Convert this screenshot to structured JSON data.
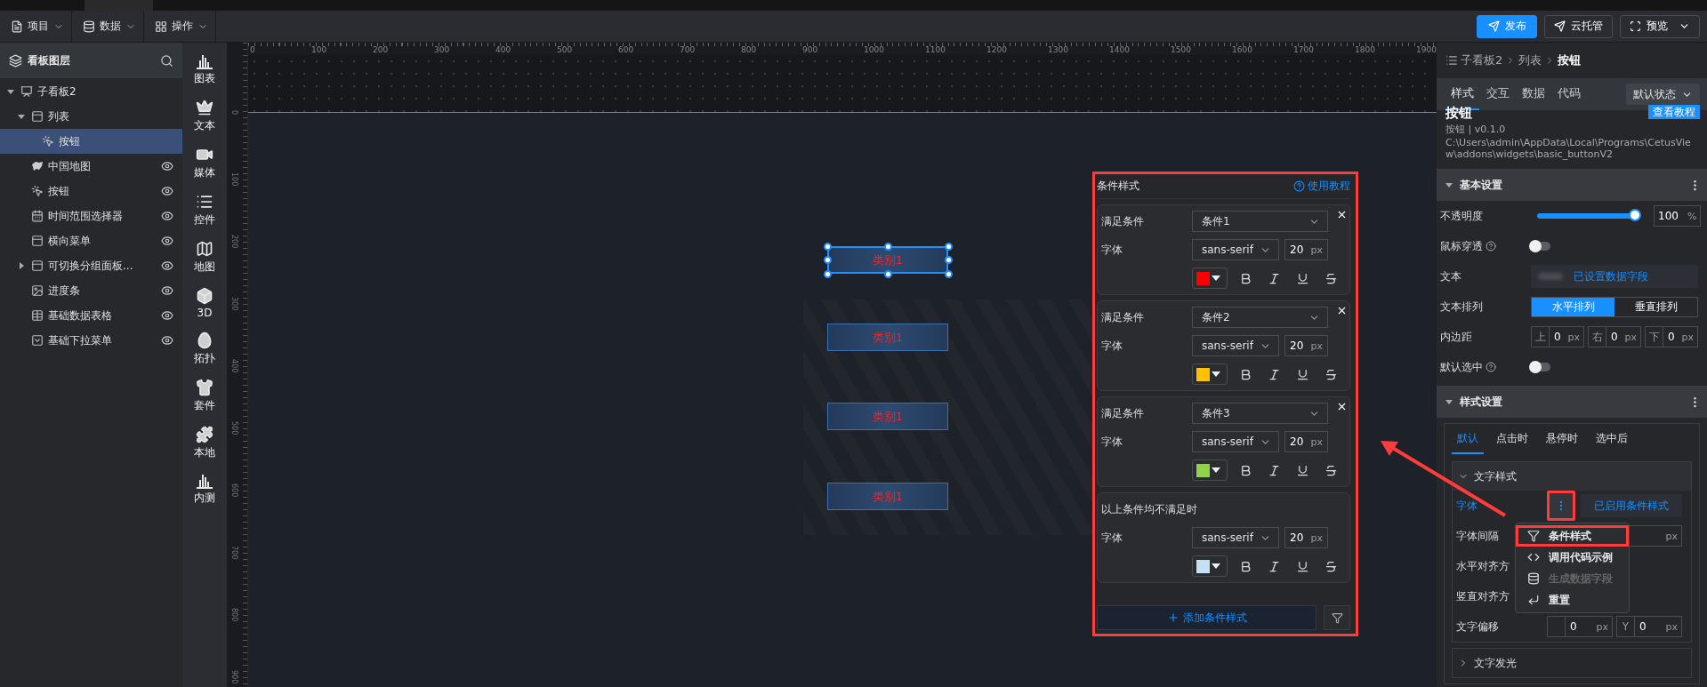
{
  "menubar": [
    {
      "label": "项目",
      "kind": "file"
    },
    {
      "label": "数据",
      "kind": "database"
    },
    {
      "label": "操作",
      "kind": "grid"
    }
  ],
  "actions": [
    {
      "label": "发布",
      "kind": "primary"
    },
    {
      "label": "云托管",
      "kind": "outline"
    },
    {
      "label": "预览",
      "kind": "dropdown"
    }
  ],
  "layers": {
    "title": "看板图层",
    "items": [
      {
        "label": "子看板2",
        "kind": "board",
        "expanded": true,
        "selected": false,
        "children": [
          {
            "label": "列表",
            "kind": "list",
            "expanded": true,
            "selected": false,
            "children": [
              {
                "label": "按钮",
                "kind": "button",
                "selected": true
              }
            ]
          },
          {
            "label": "中国地图",
            "kind": "map",
            "selected": false,
            "visible": true
          },
          {
            "label": "按钮",
            "kind": "button",
            "selected": false,
            "visible": true
          },
          {
            "label": "时间范围选择器",
            "kind": "calendar",
            "selected": false,
            "visible": true
          },
          {
            "label": "横向菜单",
            "kind": "list",
            "selected": false,
            "visible": true
          },
          {
            "label": "可切换分组面板...",
            "kind": "tabs",
            "expanded": false,
            "selected": false,
            "visible": true
          },
          {
            "label": "进度条",
            "kind": "image",
            "selected": false,
            "visible": true
          },
          {
            "label": "基础数据表格",
            "kind": "table",
            "selected": false,
            "visible": true
          },
          {
            "label": "基础下拉菜单",
            "kind": "dropdown",
            "selected": false,
            "visible": true
          }
        ]
      }
    ]
  },
  "components": [
    {
      "label": "图表",
      "kind": "chart"
    },
    {
      "label": "文本",
      "kind": "crown"
    },
    {
      "label": "媒体",
      "kind": "video"
    },
    {
      "label": "控件",
      "kind": "list"
    },
    {
      "label": "地图",
      "kind": "map"
    },
    {
      "label": "3D",
      "kind": "cube"
    },
    {
      "label": "拓扑",
      "kind": "blob"
    },
    {
      "label": "套件",
      "kind": "shirt"
    },
    {
      "label": "本地",
      "kind": "puzzle"
    },
    {
      "label": "内测",
      "kind": "chart"
    }
  ],
  "ruler": {
    "x_labels": [
      "0",
      "100",
      "200",
      "300",
      "400",
      "500",
      "600",
      "700",
      "800",
      "900",
      "1000",
      "1100",
      "1200",
      "1300",
      "1400",
      "1500",
      "1600",
      "1700",
      "1800",
      "1900"
    ],
    "y_labels": [
      "0",
      "100",
      "200",
      "300",
      "400",
      "500",
      "600",
      "700",
      "800",
      "900"
    ]
  },
  "canvas": {
    "buttons": [
      {
        "label": "类别1",
        "selected": true
      },
      {
        "label": "类别1",
        "selected": false
      },
      {
        "label": "类别1",
        "selected": false
      },
      {
        "label": "类别1",
        "selected": false
      }
    ]
  },
  "condition_panel": {
    "title": "条件样式",
    "help": "使用教程",
    "highlighted": true,
    "rules": [
      {
        "kind": "condition",
        "label": "满足条件",
        "condition": "条件1",
        "font_label": "字体",
        "font": "sans-serif",
        "size": "20",
        "unit": "px",
        "color": "#ff0000"
      },
      {
        "kind": "condition",
        "label": "满足条件",
        "condition": "条件2",
        "font_label": "字体",
        "font": "sans-serif",
        "size": "20",
        "unit": "px",
        "color": "#ffc000"
      },
      {
        "kind": "condition",
        "label": "满足条件",
        "condition": "条件3",
        "font_label": "字体",
        "font": "sans-serif",
        "size": "20",
        "unit": "px",
        "color": "#92d050"
      },
      {
        "kind": "fallback",
        "label": "以上条件均不满足时",
        "font_label": "字体",
        "font": "sans-serif",
        "size": "20",
        "unit": "px",
        "color": "#c5dff5"
      }
    ],
    "add_button": "添加条件样式"
  },
  "inspector": {
    "breadcrumb": [
      "子看板2",
      "列表",
      "按钮"
    ],
    "tabs": [
      {
        "label": "样式",
        "selected": true
      },
      {
        "label": "交互",
        "selected": false
      },
      {
        "label": "数据",
        "selected": false
      },
      {
        "label": "代码",
        "selected": false
      }
    ],
    "state_select": "默认状态",
    "widget": {
      "name": "按钮",
      "version": "按钮 | v0.1.0",
      "path": "C:\\Users\\admin\\AppData\\Local\\Programs\\CetusView\\addons\\widgets\\basic_buttonV2",
      "tutorial": "查看教程"
    },
    "basic": {
      "title": "基本设置",
      "expanded": true,
      "rows": [
        {
          "kind": "slider",
          "label": "不透明度",
          "level": 1,
          "value": "100",
          "unit": "%"
        },
        {
          "kind": "toggle",
          "label": "鼠标穿透",
          "help": true,
          "on": false
        },
        {
          "kind": "data",
          "label": "文本",
          "value": "已设置数据字段"
        },
        {
          "kind": "segmented",
          "label": "文本排列",
          "options": [
            {
              "label": "水平排列",
              "selected": true
            },
            {
              "label": "垂直排列",
              "selected": false
            }
          ]
        },
        {
          "kind": "fields",
          "label": "内边距",
          "fields": [
            {
              "prefix": "上",
              "value": "0",
              "unit": "px"
            },
            {
              "prefix": "右",
              "value": "0",
              "unit": "px"
            },
            {
              "prefix": "下",
              "value": "0",
              "unit": "px"
            }
          ]
        },
        {
          "kind": "toggle",
          "label": "默认选中",
          "help": true,
          "on": false
        }
      ]
    },
    "style": {
      "title": "样式设置",
      "expanded": true,
      "tabs": [
        {
          "label": "默认",
          "selected": true
        },
        {
          "label": "点击时",
          "selected": false
        },
        {
          "label": "悬停时",
          "selected": false
        },
        {
          "label": "选中后",
          "selected": false
        }
      ],
      "sections": [
        {
          "title": "文字样式",
          "expanded": true,
          "rows": [
            {
              "kind": "conditional",
              "label": "字体",
              "value": "已启用条件样式",
              "highlighted": true
            },
            {
              "kind": "input",
              "label": "字体间隔",
              "unit": "px"
            },
            {
              "kind": "plain",
              "label": "水平对齐方"
            },
            {
              "kind": "plain",
              "label": "竖直对齐方"
            },
            {
              "kind": "fields",
              "label": "文字偏移",
              "fields": [
                {
                  "value": "0",
                  "unit": "px"
                },
                {
                  "prefix": "Y",
                  "value": "0",
                  "unit": "px"
                }
              ]
            }
          ]
        },
        {
          "title": "文字发光",
          "expanded": false
        }
      ]
    }
  },
  "context_menu": [
    {
      "label": "条件样式",
      "kind": "filter",
      "disabled": false,
      "highlighted": true
    },
    {
      "label": "调用代码示例",
      "kind": "code",
      "disabled": false,
      "highlighted": false
    },
    {
      "label": "生成数据字段",
      "kind": "database",
      "disabled": true,
      "highlighted": false
    },
    {
      "label": "重置",
      "kind": "reset",
      "disabled": false,
      "highlighted": false
    }
  ]
}
